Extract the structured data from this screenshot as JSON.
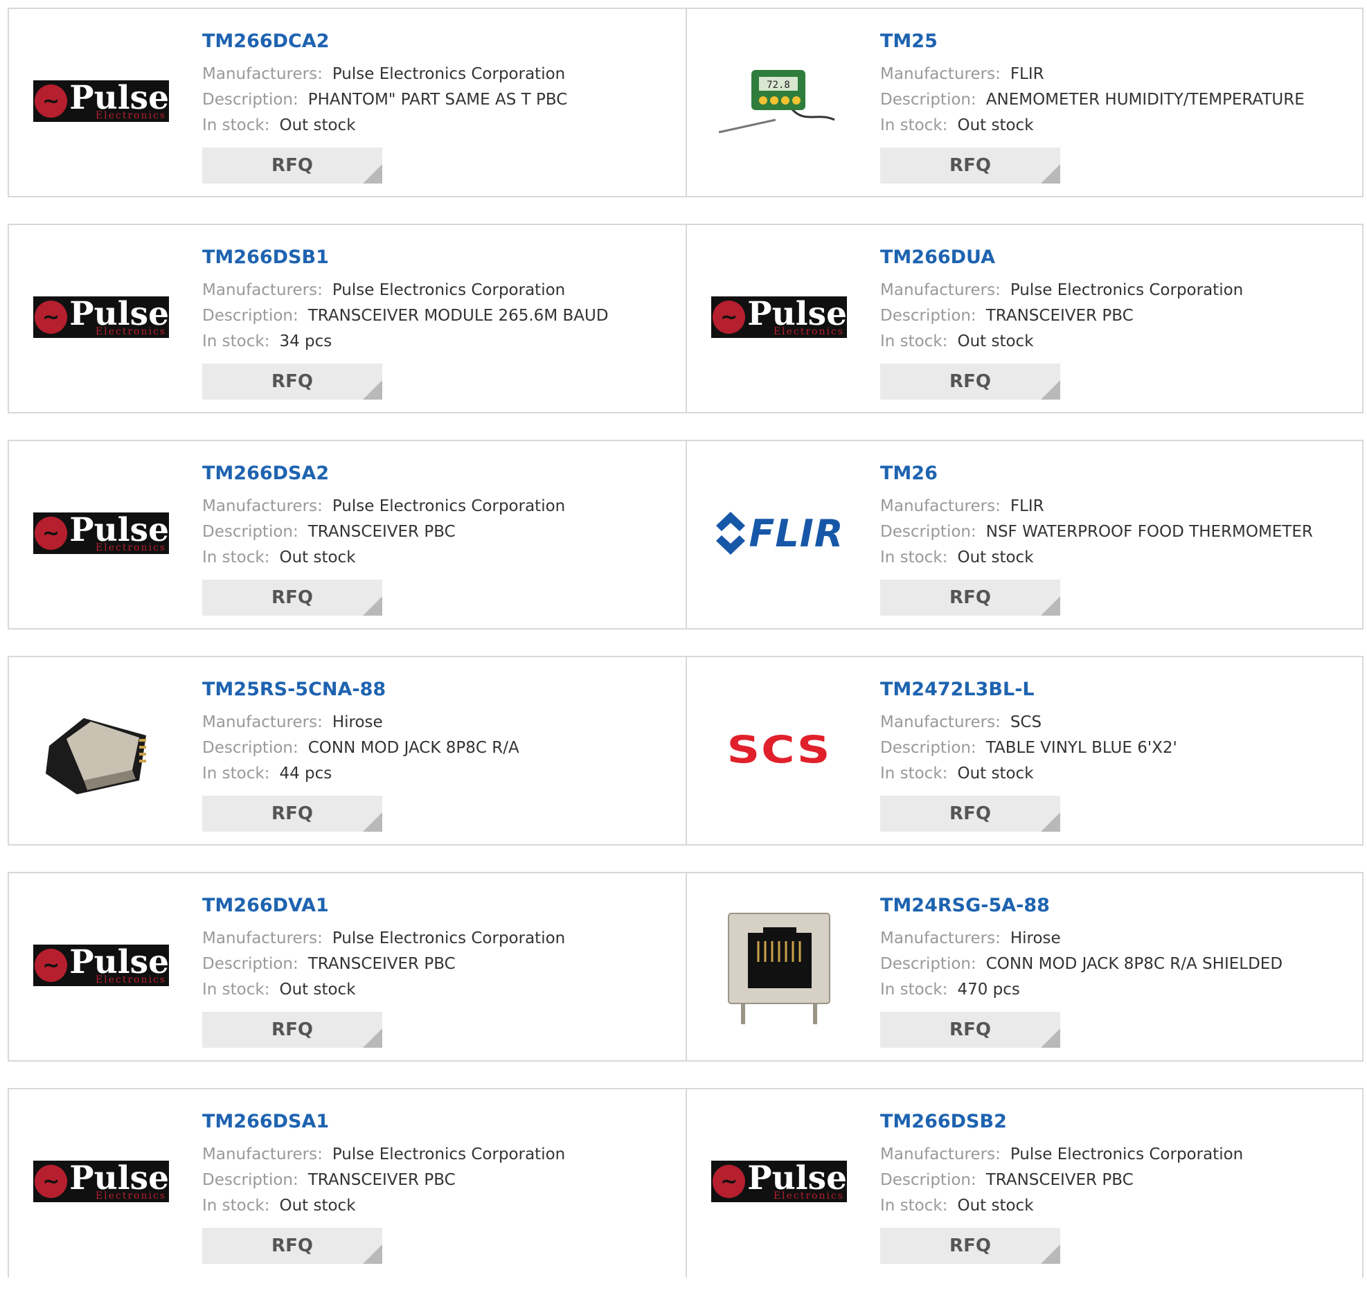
{
  "labels": {
    "manufacturers": "Manufacturers:",
    "description": "Description:",
    "in_stock": "In stock:",
    "rfq": "RFQ"
  },
  "colors": {
    "part_link": "#1e63b0",
    "label_gray": "#999999",
    "button_bg": "#eaeaea",
    "pulse_red": "#b51f2e",
    "flir_blue": "#1757a8",
    "scs_red": "#e0202a"
  },
  "products": [
    {
      "part": "TM266DCA2",
      "manufacturer": "Pulse Electronics Corporation",
      "description": "PHANTOM\" PART SAME AS T PBC",
      "stock": "Out stock",
      "logo": "pulse-electronics-logo",
      "logo_text": "Pulse",
      "logo_sub": "Electronics"
    },
    {
      "part": "TM25",
      "manufacturer": "FLIR",
      "description": "ANEMOMETER HUMIDITY/TEMPERATURE",
      "stock": "Out stock",
      "logo": "thermometer-probe-image",
      "display_value": "72.8"
    },
    {
      "part": "TM266DSB1",
      "manufacturer": "Pulse Electronics Corporation",
      "description": "TRANSCEIVER MODULE 265.6M BAUD",
      "stock": "34 pcs",
      "logo": "pulse-electronics-logo",
      "logo_text": "Pulse",
      "logo_sub": "Electronics"
    },
    {
      "part": "TM266DUA",
      "manufacturer": "Pulse Electronics Corporation",
      "description": "TRANSCEIVER PBC",
      "stock": "Out stock",
      "logo": "pulse-electronics-logo",
      "logo_text": "Pulse",
      "logo_sub": "Electronics"
    },
    {
      "part": "TM266DSA2",
      "manufacturer": "Pulse Electronics Corporation",
      "description": "TRANSCEIVER PBC",
      "stock": "Out stock",
      "logo": "pulse-electronics-logo",
      "logo_text": "Pulse",
      "logo_sub": "Electronics"
    },
    {
      "part": "TM26",
      "manufacturer": "FLIR",
      "description": "NSF WATERPROOF FOOD THERMOMETER",
      "stock": "Out stock",
      "logo": "flir-logo",
      "logo_text": "FLIR"
    },
    {
      "part": "TM25RS-5CNA-88",
      "manufacturer": "Hirose",
      "description": "CONN MOD JACK 8P8C R/A",
      "stock": "44 pcs",
      "logo": "connector-jack-image"
    },
    {
      "part": "TM2472L3BL-L",
      "manufacturer": "SCS",
      "description": "TABLE VINYL BLUE 6'X2'",
      "stock": "Out stock",
      "logo": "scs-logo",
      "logo_text": "SCS"
    },
    {
      "part": "TM266DVA1",
      "manufacturer": "Pulse Electronics Corporation",
      "description": "TRANSCEIVER PBC",
      "stock": "Out stock",
      "logo": "pulse-electronics-logo",
      "logo_text": "Pulse",
      "logo_sub": "Electronics"
    },
    {
      "part": "TM24RSG-5A-88",
      "manufacturer": "Hirose",
      "description": "CONN MOD JACK 8P8C R/A SHIELDED",
      "stock": "470 pcs",
      "logo": "rj45-jack-image"
    },
    {
      "part": "TM266DSA1",
      "manufacturer": "Pulse Electronics Corporation",
      "description": "TRANSCEIVER PBC",
      "stock": "Out stock",
      "logo": "pulse-electronics-logo",
      "logo_text": "Pulse",
      "logo_sub": "Electronics"
    },
    {
      "part": "TM266DSB2",
      "manufacturer": "Pulse Electronics Corporation",
      "description": "TRANSCEIVER PBC",
      "stock": "Out stock",
      "logo": "pulse-electronics-logo",
      "logo_text": "Pulse",
      "logo_sub": "Electronics"
    }
  ]
}
